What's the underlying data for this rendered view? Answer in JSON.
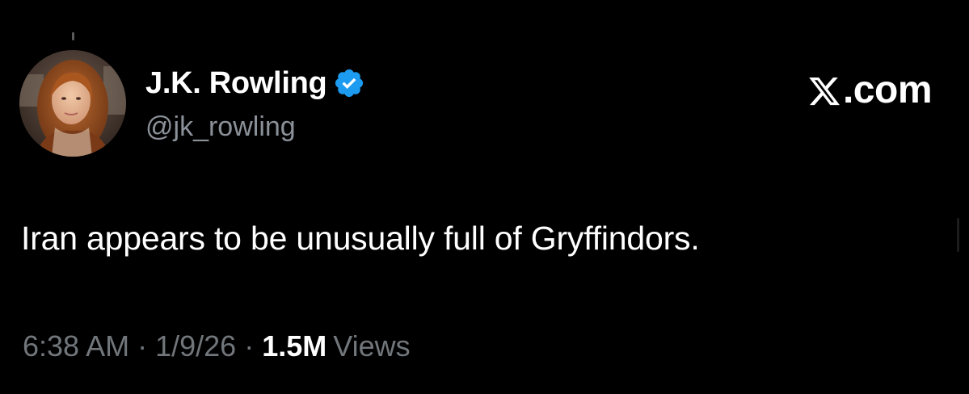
{
  "author": {
    "display_name": "J.K. Rowling",
    "handle": "@jk_rowling",
    "verified": true,
    "avatar_icon": "profile-photo",
    "verified_icon": "verified-badge-icon",
    "verified_color": "#1d9bf0"
  },
  "site": {
    "logo_icon": "x-logo-icon",
    "label": ".com"
  },
  "tweet": {
    "text": "Iran appears to be unusually full of Gryffindors.",
    "time": "6:38 AM",
    "date": "1/9/26",
    "separator": "·",
    "views_count": "1.5M",
    "views_label": "Views"
  },
  "colors": {
    "background": "#000000",
    "primary_text": "#ffffff",
    "secondary_text": "#71767b"
  }
}
